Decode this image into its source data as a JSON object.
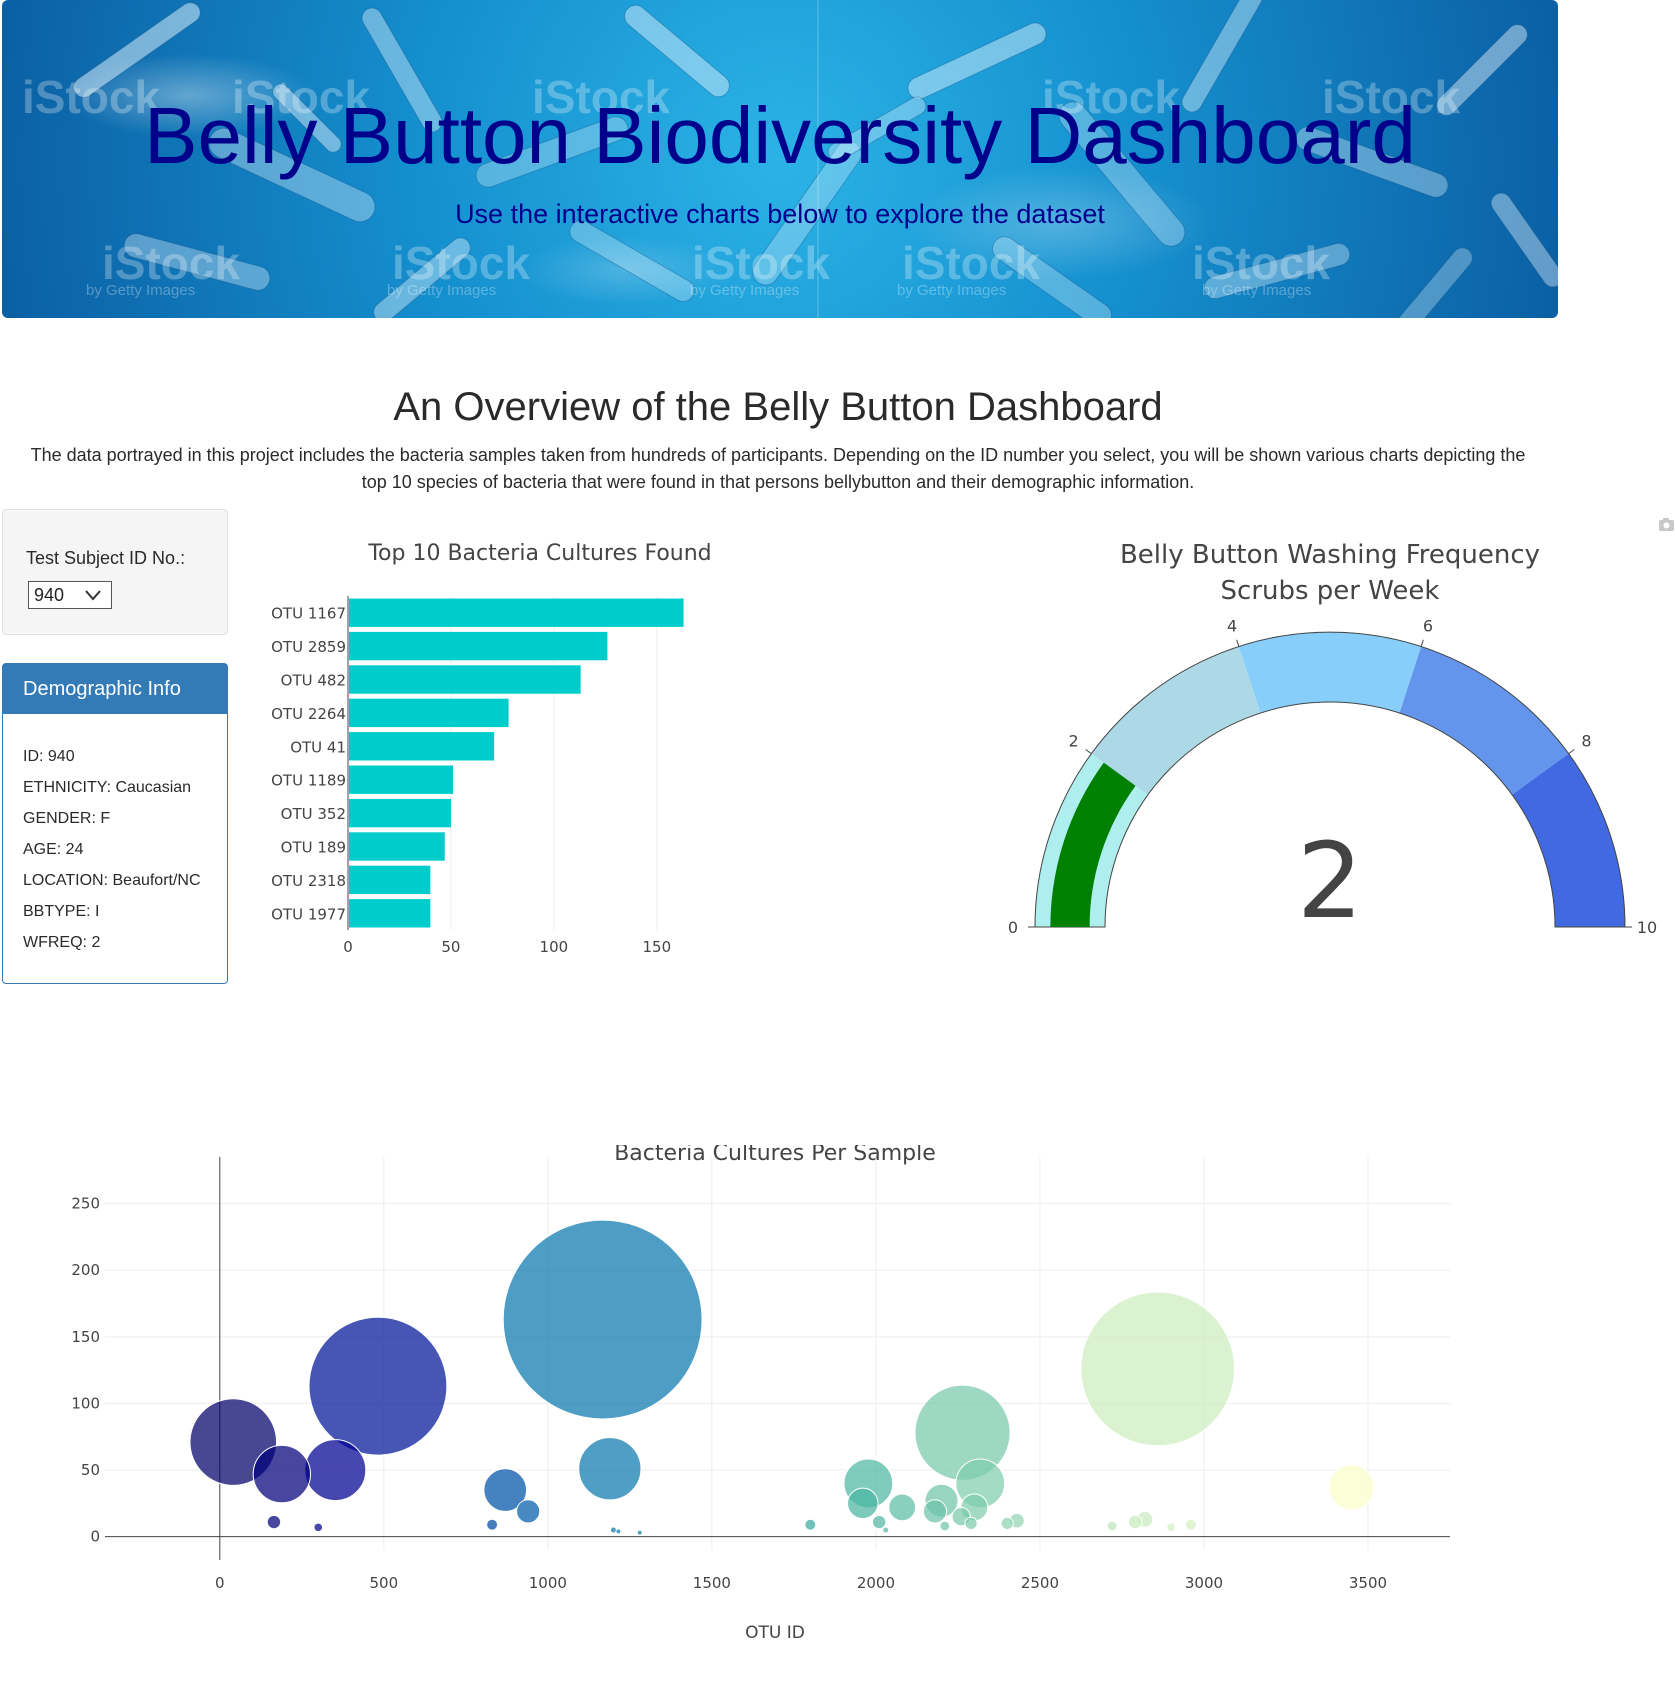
{
  "header": {
    "title": "Belly Button Biodiversity Dashboard",
    "subtitle": "Use the interactive charts below to explore the dataset",
    "watermark": "iStock",
    "watermark_sub": "by Getty Images"
  },
  "overview": {
    "title": "An Overview of the Belly Button Dashboard",
    "text": "The data portrayed in this project includes the bacteria samples taken from hundreds of participants. Depending on the ID number you select, you will be shown various charts depicting the top 10 species of bacteria that were found in that persons bellybutton and their demographic information."
  },
  "selector": {
    "label": "Test Subject ID No.:",
    "selected": "940"
  },
  "demographics": {
    "heading": "Demographic Info",
    "rows": [
      "ID: 940",
      "ETHNICITY: Caucasian",
      "GENDER: F",
      "AGE: 24",
      "LOCATION: Beaufort/NC",
      "BBTYPE: I",
      "WFREQ: 2"
    ]
  },
  "chart_data": [
    {
      "type": "bar",
      "orientation": "horizontal",
      "title": "Top 10 Bacteria Cultures Found",
      "categories": [
        "OTU 1167",
        "OTU 2859",
        "OTU 482",
        "OTU 2264",
        "OTU 41",
        "OTU 1189",
        "OTU 352",
        "OTU 189",
        "OTU 2318",
        "OTU 1977"
      ],
      "values": [
        163,
        126,
        113,
        78,
        71,
        51,
        50,
        47,
        40,
        40
      ],
      "xlim": [
        0,
        170
      ],
      "xticks": [
        0,
        50,
        100,
        150
      ],
      "grid": true,
      "color": "#00cccc"
    },
    {
      "type": "gauge",
      "title": "Belly Button Washing Frequency",
      "subtitle": "Scrubs per Week",
      "value": 2,
      "range": [
        0,
        10
      ],
      "ticks": [
        0,
        2,
        4,
        6,
        8,
        10
      ],
      "bar_color": "#008000",
      "steps": [
        {
          "range": [
            0,
            2
          ],
          "color": "#afeeee"
        },
        {
          "range": [
            2,
            4
          ],
          "color": "#add8e6"
        },
        {
          "range": [
            4,
            6
          ],
          "color": "#87cefa"
        },
        {
          "range": [
            6,
            8
          ],
          "color": "#6495ed"
        },
        {
          "range": [
            8,
            10
          ],
          "color": "#4169e1"
        }
      ]
    },
    {
      "type": "scatter",
      "mode": "bubble",
      "title": "Bacteria Cultures Per Sample",
      "xlabel": "OTU ID",
      "ylabel": "",
      "xlim": [
        -350,
        3750
      ],
      "ylim": [
        -10,
        285
      ],
      "xticks": [
        0,
        500,
        1000,
        1500,
        2000,
        2500,
        3000,
        3500
      ],
      "yticks": [
        0,
        50,
        100,
        150,
        200,
        250
      ],
      "grid": true,
      "colorscale": "Earth",
      "points": [
        {
          "x": 41,
          "y": 71
        },
        {
          "x": 189,
          "y": 47
        },
        {
          "x": 165,
          "y": 11
        },
        {
          "x": 300,
          "y": 7
        },
        {
          "x": 352,
          "y": 50
        },
        {
          "x": 482,
          "y": 113
        },
        {
          "x": 830,
          "y": 9
        },
        {
          "x": 870,
          "y": 35
        },
        {
          "x": 940,
          "y": 19
        },
        {
          "x": 1167,
          "y": 163
        },
        {
          "x": 1189,
          "y": 51
        },
        {
          "x": 1200,
          "y": 5
        },
        {
          "x": 1215,
          "y": 4
        },
        {
          "x": 1280,
          "y": 3
        },
        {
          "x": 1800,
          "y": 9
        },
        {
          "x": 1977,
          "y": 40
        },
        {
          "x": 1960,
          "y": 25
        },
        {
          "x": 2010,
          "y": 11
        },
        {
          "x": 2080,
          "y": 22
        },
        {
          "x": 2030,
          "y": 5
        },
        {
          "x": 2200,
          "y": 27
        },
        {
          "x": 2180,
          "y": 19
        },
        {
          "x": 2210,
          "y": 8
        },
        {
          "x": 2264,
          "y": 78
        },
        {
          "x": 2260,
          "y": 15
        },
        {
          "x": 2290,
          "y": 10
        },
        {
          "x": 2318,
          "y": 40
        },
        {
          "x": 2300,
          "y": 22
        },
        {
          "x": 2400,
          "y": 10
        },
        {
          "x": 2430,
          "y": 12
        },
        {
          "x": 2720,
          "y": 8
        },
        {
          "x": 2790,
          "y": 11
        },
        {
          "x": 2820,
          "y": 13
        },
        {
          "x": 2859,
          "y": 126
        },
        {
          "x": 2900,
          "y": 7
        },
        {
          "x": 2960,
          "y": 9
        },
        {
          "x": 3450,
          "y": 37
        }
      ]
    }
  ]
}
